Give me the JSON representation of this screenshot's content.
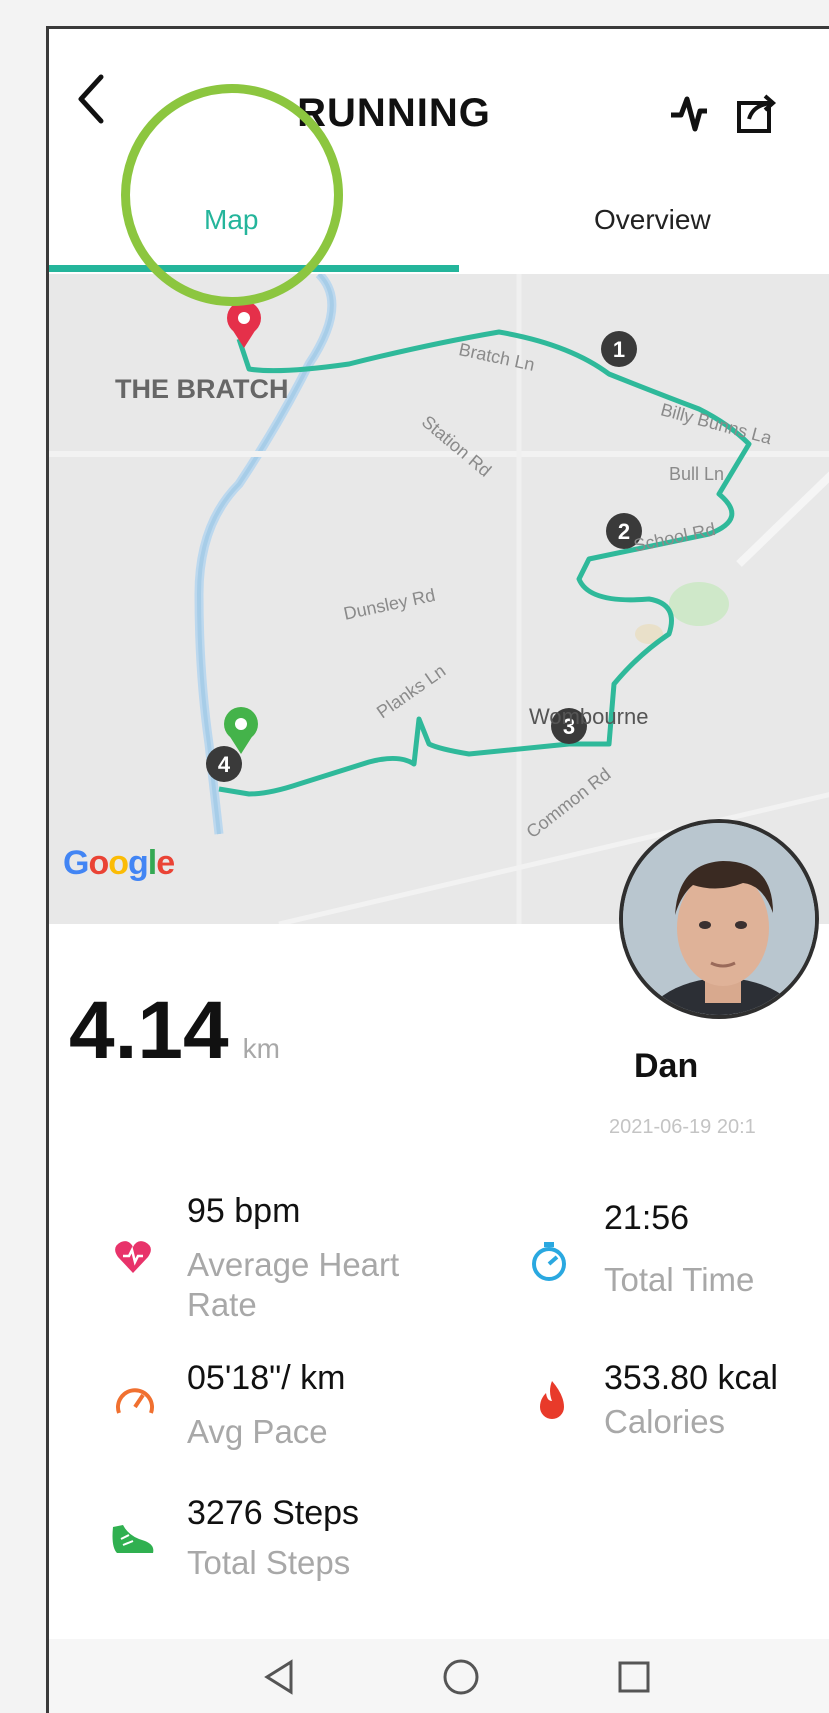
{
  "header": {
    "title": "RUNNING",
    "back_icon": "chevron-left-icon",
    "activity_icon": "activity-icon",
    "share_icon": "share-icon"
  },
  "tabs": [
    {
      "label": "Map",
      "active": true
    },
    {
      "label": "Overview",
      "active": false
    }
  ],
  "colors": {
    "accent": "#24b59b",
    "highlight_ring": "#8cc63f",
    "heart": "#e8336a",
    "timer": "#2aa8e0",
    "pace": "#f07030",
    "calories": "#e83a2a",
    "steps": "#30b050"
  },
  "map": {
    "place_label": "THE BRATCH",
    "attribution": "Google",
    "streets": [
      "Bratch Ln",
      "Station Rd",
      "Dunsley Rd",
      "Planks Ln",
      "Wombourne",
      "Billy Bunns La",
      "School Rd",
      "Bull Ln",
      "Common Rd"
    ],
    "waypoints": [
      "1",
      "2",
      "3",
      "4"
    ]
  },
  "summary": {
    "distance": "4.14",
    "distance_unit": "km",
    "user_name": "Dan",
    "datetime": "2021-06-19 20:1"
  },
  "stats": {
    "heart_rate": {
      "value": "95 bpm",
      "label_line1": "Average Heart",
      "label_line2": "Rate",
      "icon": "heart-rate-icon"
    },
    "total_time": {
      "value": "21:56",
      "label": "Total Time",
      "icon": "stopwatch-icon"
    },
    "avg_pace": {
      "value": "05'18\"/ km",
      "label": "Avg Pace",
      "icon": "speedometer-icon"
    },
    "calories": {
      "value": "353.80 kcal",
      "label": "Calories",
      "icon": "flame-icon"
    },
    "steps": {
      "value": "3276 Steps",
      "label": "Total Steps",
      "icon": "shoe-icon"
    }
  },
  "navbar": {
    "back": "nav-back-icon",
    "home": "nav-home-icon",
    "recents": "nav-recents-icon"
  }
}
